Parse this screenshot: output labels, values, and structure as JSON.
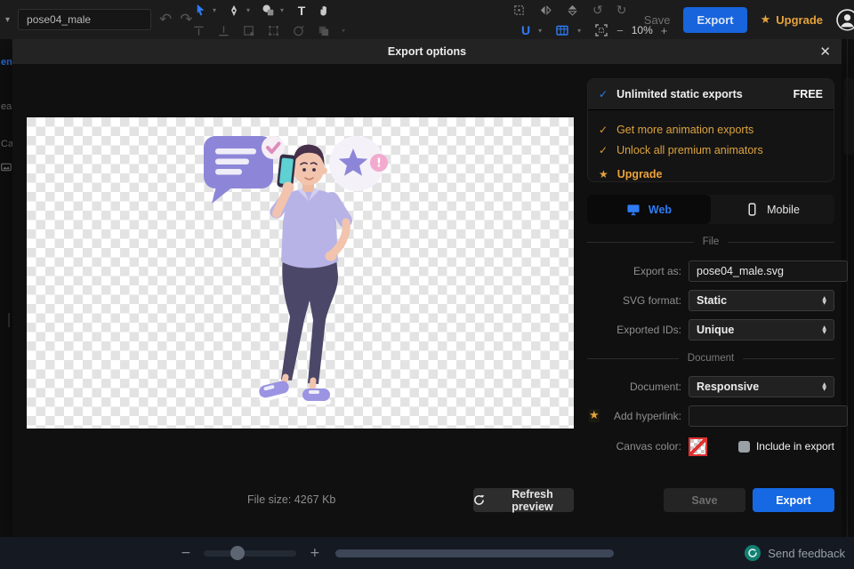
{
  "topbar": {
    "filename": "pose04_male",
    "save_label": "Save",
    "export_label": "Export",
    "upgrade_label": "Upgrade",
    "zoom_level": "10%"
  },
  "sidebar_fragments": [
    "en",
    "ea",
    "Ca"
  ],
  "modal": {
    "title": "Export options",
    "promo": {
      "main_label": "Unlimited static exports",
      "main_badge": "FREE",
      "items": [
        "Get more animation exports",
        "Unlock all premium animators"
      ],
      "upgrade_label": "Upgrade"
    },
    "tabs": [
      {
        "label": "Web"
      },
      {
        "label": "Mobile"
      }
    ],
    "file_section": {
      "title": "File",
      "export_as_label": "Export as:",
      "export_as_value": "pose04_male.svg",
      "svg_format_label": "SVG format:",
      "svg_format_value": "Static",
      "exported_ids_label": "Exported IDs:",
      "exported_ids_value": "Unique"
    },
    "document_section": {
      "title": "Document",
      "document_label": "Document:",
      "document_value": "Responsive",
      "hyperlink_label": "Add hyperlink:",
      "hyperlink_value": "",
      "canvas_color_label": "Canvas color:",
      "include_label": "Include in export"
    },
    "footer": {
      "file_size": "File size: 4267 Kb",
      "refresh_label": "Refresh preview",
      "save_label": "Save",
      "export_label": "Export"
    }
  },
  "statusbar": {
    "feedback_label": "Send feedback"
  },
  "colors": {
    "accent_blue": "#2e7cf6",
    "export_blue": "#1668e3",
    "gold": "#e5a33c",
    "feedback_teal": "#137f72",
    "swatch_red": "#e03131"
  }
}
